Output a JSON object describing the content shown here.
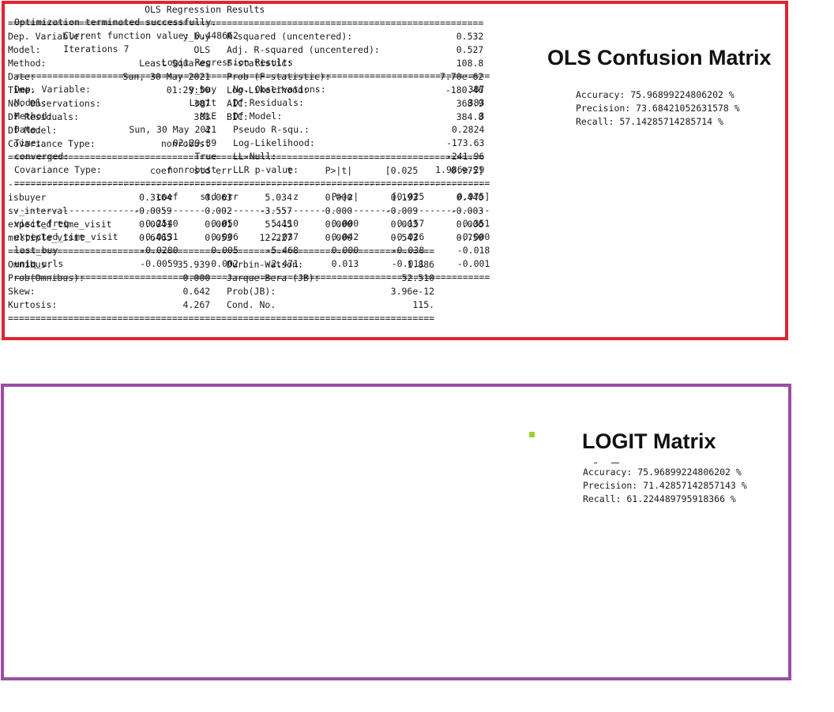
{
  "ols": {
    "border_color": "#e0242f",
    "title": "OLS Confusion Matrix",
    "summary_text": "                         OLS Regression Results                        \n=======================================================================================\nDep. Variable:                  y_buy   R-squared (uncentered):                   0.532\nModel:                            OLS   Adj. R-squared (uncentered):              0.527\nMethod:                 Least Squares   F-statistic:                              108.8\nDate:                Sun, 30 May 2021   Prob (F-statistic):                    7.70e-62\nTime:                        01:29:50   Log-Likelihood:                         -180.46\nNo. Observations:                 387   AIC:                                      368.9\nDf Residuals:                     383   BIC:                                      384.8\nDf Model:                           4                                                  \nCovariance Type:            nonrobust                                                  \n=======================================================================================\n                          coef    std err          t      P>|t|      [0.025      0.975]\n---------------------------------------------------------------------------------------\nisbuyer                 0.3164      0.063      5.034      0.000       0.193       0.440\nsv_interval            -0.0059      0.002     -3.557      0.000      -0.009      -0.003\nexpected_time_visit     0.0041      0.001      5.445      0.000       0.003       0.006\nmultiple_visit          0.6465      0.053     12.227      0.000       0.543       0.750\n==============================================================================\nOmnibus:                       35.939   Durbin-Watson:                   1.886\nProb(Omnibus):                  0.000   Jarque-Bera (JB):               52.510\nSkew:                           0.642   Prob(JB):                     3.96e-12\nKurtosis:                       4.267   Cond. No.                         115.\n==============================================================================",
    "metrics_text": "Accuracy: 75.96899224806202 %\nPrecision: 73.68421052631578 %\nRecall: 57.14285714285714 %"
  },
  "logit": {
    "border_color": "#9b4da6",
    "title": "LOGIT Matrix",
    "summary_text": "Optimization terminated successfully.\n         Current function value: 0.448662\n         Iterations 7\n                           Logit Regression Results                           \n=======================================================================================\nDep. Variable:                  y_buy   No. Observations:                          387\nModel:                          Logit   Df Residuals:                              383\nMethod:                           MLE   Df Model:                                    3\nDate:                Sun, 30 May 2021   Pseudo R-squ.:                          0.2824\nTime:                        02:29:39   Log-Likelihood:                        -173.63\nconverged:                       True   LL-Null:                               -241.96\nCovariance Type:            nonrobust   LLR p-value:                         1.986e-29\n=======================================================================================\n                          coef    std err          z      P>|z|      [0.025      0.975]\n---------------------------------------------------------------------------------------\nvisit_freq              0.2540      0.050      5.110      0.000       0.157       0.351\nexpected_time_visit    -0.0131      0.006     -2.037      0.042      -0.026      -0.000\nlast_buy               -0.0280      0.005     -5.468      0.000      -0.038      -0.018\nuniq_urls              -0.0059      0.002     -2.471      0.013      -0.011      -0.001\n=======================================================================================",
    "metrics_text": "Accuracy: 75.96899224806202 %\nPrecision: 71.42857142857143 %\nRecall: 61.224489795918366 %"
  },
  "accent_colors": {
    "dot": "#9ccf2e"
  }
}
